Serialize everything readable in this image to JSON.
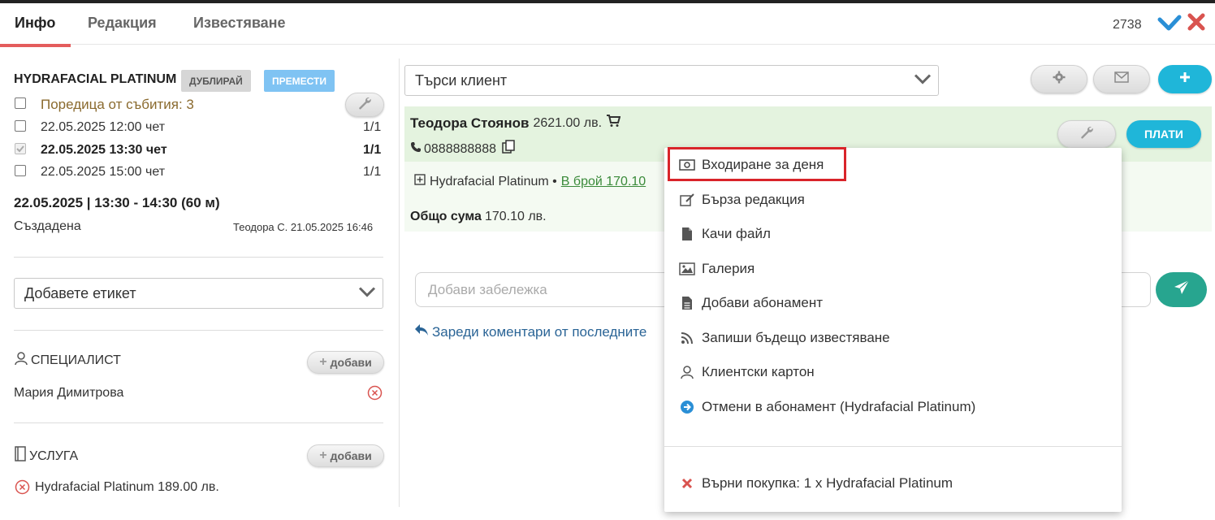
{
  "tabs": [
    {
      "label": "Инфо",
      "active": true
    },
    {
      "label": "Редакция",
      "active": false
    },
    {
      "label": "Известяване",
      "active": false
    }
  ],
  "record_number": "2738",
  "service": {
    "title": "HYDRAFACIAL PLATINUM",
    "duplicate_label": "ДУБЛИРАЙ",
    "move_label": "ПРЕМЕСТИ",
    "series_label": "Поредица от събития: 3",
    "events": [
      {
        "label": "22.05.2025 12:00 чет",
        "count": "1/1",
        "checked": false,
        "current": false
      },
      {
        "label": "22.05.2025 13:30 чет",
        "count": "1/1",
        "checked": true,
        "current": true
      },
      {
        "label": "22.05.2025 15:00 чет",
        "count": "1/1",
        "checked": false,
        "current": false
      }
    ],
    "datetime": "22.05.2025 | 13:30 - 14:30 (60 м)",
    "created_label": "Създадена",
    "created_by": "Теодора С. 21.05.2025 16:46"
  },
  "tag_select": {
    "value": "Добавете етикет"
  },
  "specialist": {
    "heading": "СПЕЦИАЛИСТ",
    "add_label": "добави",
    "name": "Мария Димитрова"
  },
  "service_section": {
    "heading": "УСЛУГА",
    "add_label": "добави",
    "item": "Hydrafacial Platinum 189.00 лв."
  },
  "client_search": {
    "value": "Търси клиент"
  },
  "client": {
    "name": "Теодора Стоянов",
    "balance": "2621.00 лв.",
    "phone": "0888888888",
    "pay_label": "ПЛАТИ",
    "service_line_prefix": "Hydrafacial Platinum •",
    "service_line_link": "В брой 170.10",
    "total_label": "Общо сума",
    "total_value": "170.10 лв."
  },
  "note": {
    "placeholder": "Добави забележка"
  },
  "load_comments": "Зареди коментари от последните",
  "menu": {
    "items": [
      {
        "label": "Входиране за деня",
        "icon": "money-icon",
        "highlighted": true
      },
      {
        "label": "Бърза редакция",
        "icon": "edit-icon"
      },
      {
        "label": "Качи файл",
        "icon": "file-icon"
      },
      {
        "label": "Галерия",
        "icon": "image-icon"
      },
      {
        "label": "Добави абонамент",
        "icon": "document-icon"
      },
      {
        "label": "Запиши бъдещо известяване",
        "icon": "rss-icon"
      },
      {
        "label": "Клиентски картон",
        "icon": "user-icon"
      },
      {
        "label": "Отмени в абонамент (Hydrafacial Platinum)",
        "icon": "arrow-circle-right-icon"
      }
    ],
    "return_item": {
      "label": "Върни покупка: 1 x Hydrafacial Platinum",
      "icon": "close-icon"
    }
  },
  "colors": {
    "accent_teal": "#1fb6d9",
    "send_green": "#27a58f",
    "highlight_red": "#d9242a",
    "tab_underline": "#e45c5c",
    "move_blue": "#7fc3f3",
    "client_bg": "#e4f3df"
  }
}
